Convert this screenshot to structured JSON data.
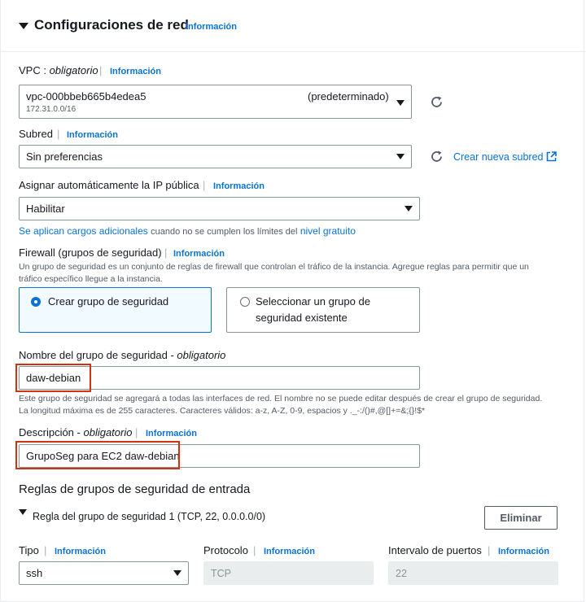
{
  "header": {
    "title": "Configuraciones de red",
    "info": "Información"
  },
  "vpc": {
    "label": "VPC",
    "required": "obligatorio",
    "info": "Información",
    "value": "vpc-000bbeb665b4edea5",
    "tag": "(predeterminado)",
    "cidr": "172.31.0.0/16"
  },
  "subnet": {
    "label": "Subred",
    "info": "Información",
    "value": "Sin preferencias",
    "create_link": "Crear nueva subred"
  },
  "public_ip": {
    "label": "Asignar automáticamente la IP pública",
    "info": "Información",
    "value": "Habilitar",
    "note_link": "Se aplican cargos adicionales",
    "note_middle": "cuando no se cumplen los límites del",
    "note_link2": "nivel gratuito"
  },
  "firewall": {
    "label": "Firewall (grupos de seguridad)",
    "info": "Información",
    "description_line1": "Un grupo de seguridad es un conjunto de reglas de firewall que controlan el tráfico de la instancia. Agregue reglas para permitir que un",
    "description_line2": "tráfico específico llegue a la instancia.",
    "option_create": "Crear grupo de seguridad",
    "option_select_line1": "Seleccionar un grupo de",
    "option_select_line2": "seguridad existente"
  },
  "sg_name": {
    "label": "Nombre del grupo de seguridad",
    "required": "obligatorio",
    "value": "daw-debian",
    "help_line1": "Este grupo de seguridad se agregará a todas las interfaces de red. El nombre no se puede editar después de crear el grupo de seguridad.",
    "help_line2": "La longitud máxima es de 255 caracteres. Caracteres válidos: a-z, A-Z, 0-9, espacios y ._-:/()#,@[]+=&;{}!$*"
  },
  "description": {
    "label": "Descripción",
    "required": "obligatorio",
    "info": "Información",
    "value": "GrupoSeg para EC2 daw-debian"
  },
  "inbound": {
    "title": "Reglas de grupos de seguridad de entrada",
    "rule_label": "Regla del grupo de seguridad 1 (TCP, 22, 0.0.0.0/0)",
    "delete_button": "Eliminar",
    "type_label": "Tipo",
    "type_info": "Información",
    "type_value": "ssh",
    "protocol_label": "Protocolo",
    "protocol_info": "Información",
    "protocol_value": "TCP",
    "port_label": "Intervalo de puertos",
    "port_info": "Información",
    "port_value": "22"
  },
  "colors": {
    "link": "#0972d3",
    "highlight": "#d13212",
    "selected_bg": "#f1faff"
  },
  "icons": [
    "caret-down-icon",
    "refresh-icon",
    "external-link-icon",
    "dropdown-arrow-icon"
  ]
}
